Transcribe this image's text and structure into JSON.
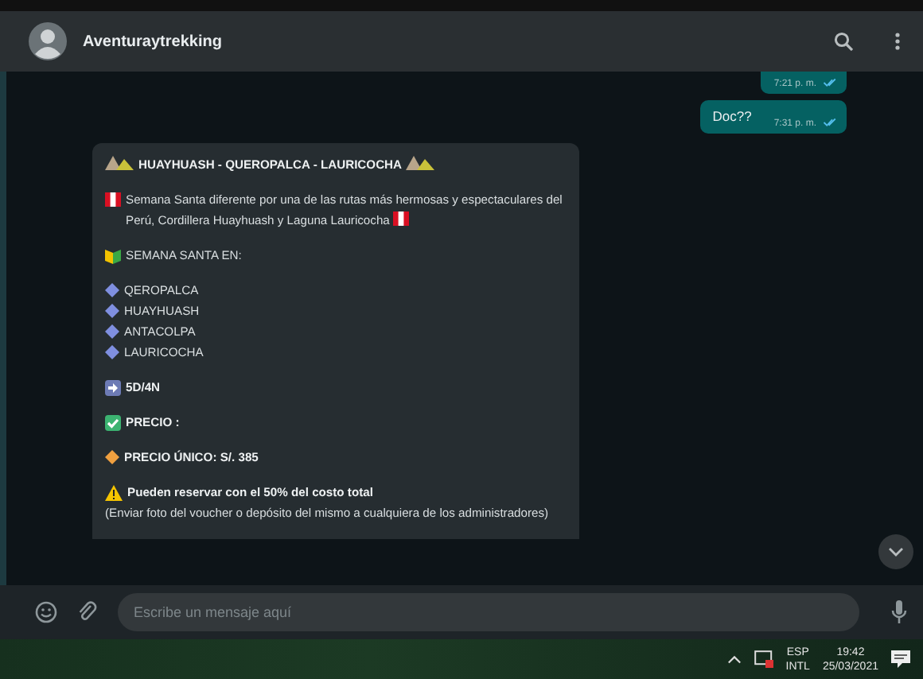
{
  "header": {
    "name": "Aventuraytrekking"
  },
  "sent": [
    {
      "time": "7:21 p. m.",
      "read": true
    },
    {
      "text": "Doc??",
      "time": "7:31 p. m.",
      "read": true
    }
  ],
  "received": {
    "blocks": [
      {
        "lines": [
          {
            "kind": "title",
            "text": "HUAYHUASH - QUEROPALCA - LAURICOCHA"
          }
        ]
      },
      {
        "lines": [
          {
            "kind": "flagged",
            "text": "Semana Santa diferente por una de las rutas más hermosas y espectaculares del Perú, Cordillera Huayhuash y Laguna Lauricocha"
          }
        ]
      },
      {
        "lines": [
          {
            "kind": "heading",
            "text": "SEMANA SANTA EN:"
          }
        ]
      },
      {
        "lines": [
          {
            "kind": "bullet",
            "text": "QEROPALCA"
          },
          {
            "kind": "bullet",
            "text": "HUAYHUASH"
          },
          {
            "kind": "bullet",
            "text": "ANTACOLPA"
          },
          {
            "kind": "bullet",
            "text": "LAURICOCHA"
          }
        ]
      },
      {
        "lines": [
          {
            "kind": "duration",
            "text": "5D/4N"
          }
        ]
      },
      {
        "lines": [
          {
            "kind": "checked",
            "text": "PRECIO :"
          }
        ]
      },
      {
        "lines": [
          {
            "kind": "price",
            "text": "PRECIO ÚNICO: S/. 385"
          }
        ]
      },
      {
        "lines": [
          {
            "kind": "warning",
            "text": "Pueden reservar con el 50% del costo total"
          },
          {
            "kind": "plain",
            "text": "(Enviar foto del voucher o depósito del mismo a cualquiera de los administradores)"
          }
        ]
      }
    ]
  },
  "composer": {
    "placeholder": "Escribe un mensaje aquí"
  },
  "taskbar": {
    "language": "ESP",
    "layout": "INTL",
    "time": "19:42",
    "date": "25/03/2021"
  }
}
